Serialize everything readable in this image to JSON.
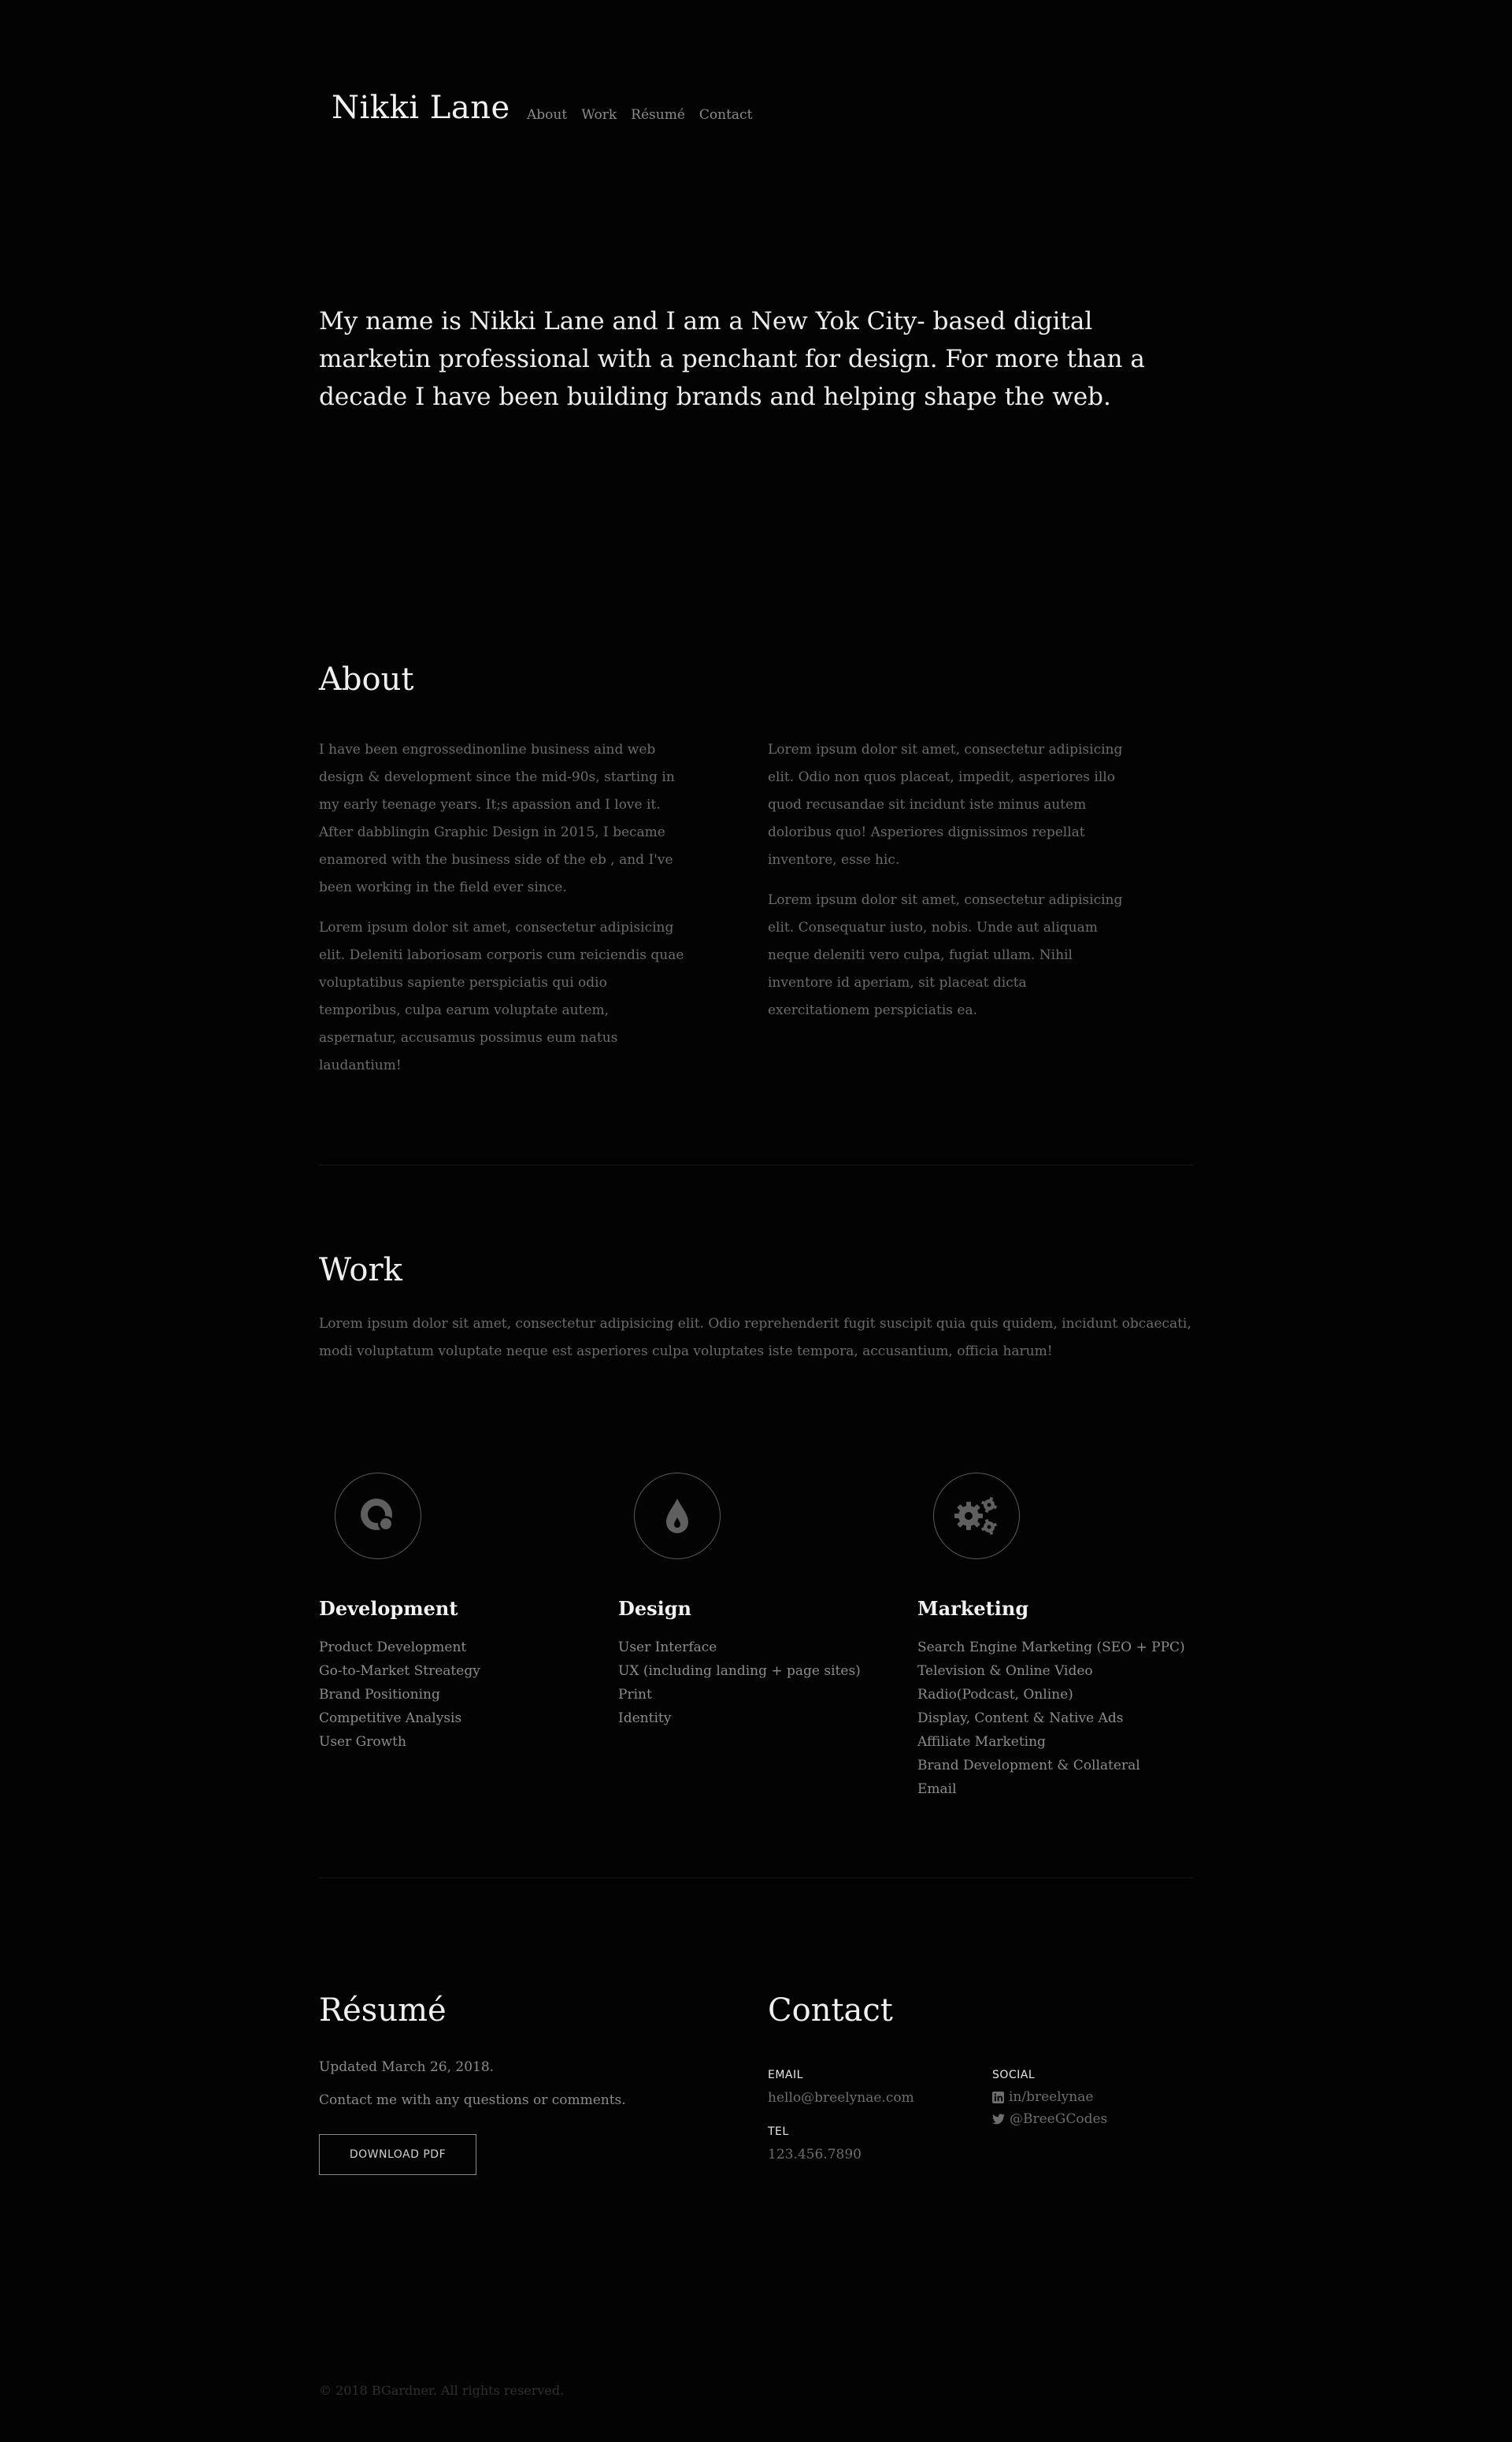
{
  "header": {
    "brand": "Nikki Lane",
    "nav": [
      "About",
      "Work",
      "Résumé",
      "Contact"
    ]
  },
  "intro": "My name is Nikki Lane and I am a New Yok City- based digital marketin professional with a penchant for design. For more than a decade I have been building brands and helping shape the web.",
  "about": {
    "title": "About",
    "left": [
      "I have been engrossedinonline business aind web design & development since the mid-90s, starting in my early teenage years. It;s apassion and I love it. After dabblingin Graphic Design in 2015, I became enamored with the business side of the eb , and I've been working in the field ever since.",
      "Lorem ipsum dolor sit amet, consectetur adipisicing elit. Deleniti laboriosam corporis cum reiciendis quae voluptatibus sapiente perspiciatis qui odio temporibus, culpa earum voluptate autem, aspernatur, accusamus possimus eum natus laudantium!"
    ],
    "right": [
      "Lorem ipsum dolor sit amet, consectetur adipisicing elit. Odio non quos placeat, impedit, asperiores illo quod recusandae sit incidunt iste minus autem doloribus quo! Asperiores dignissimos repellat inventore, esse hic.",
      "Lorem ipsum dolor sit amet, consectetur adipisicing elit. Consequatur iusto, nobis. Unde aut aliquam neque deleniti vero culpa, fugiat ullam. Nihil inventore id aperiam, sit placeat dicta exercitationem perspiciatis ea."
    ]
  },
  "work": {
    "title": "Work",
    "intro": "Lorem ipsum dolor sit amet, consectetur adipisicing elit. Odio reprehenderit fugit suscipit quia quis quidem, incidunt obcaecati, modi voluptatum voluptate neque est asperiores culpa voluptates iste tempora, accusantium, officia harum!",
    "columns": [
      {
        "icon": "development-icon",
        "title": "Development",
        "items": [
          "Product Development",
          "Go-to-Market Streategy",
          "Brand Positioning",
          "Competitive Analysis",
          "User Growth"
        ]
      },
      {
        "icon": "droplet-icon",
        "title": "Design",
        "items": [
          "User Interface",
          "UX (including landing + page sites)",
          "Print",
          "Identity"
        ]
      },
      {
        "icon": "gears-icon",
        "title": "Marketing",
        "items": [
          "Search Engine Marketing (SEO + PPC)",
          "Television & Online Video",
          "Radio(Podcast, Online)",
          "Display, Content & Native Ads",
          "Affiliate Marketing",
          "Brand Development & Collateral",
          "Email"
        ]
      }
    ]
  },
  "resume": {
    "title": "Résumé",
    "updated": "Updated March 26, 2018.",
    "contact_note": "Contact me with any questions or comments.",
    "button": "DOWNLOAD PDF"
  },
  "contact": {
    "title": "Contact",
    "email_label": "EMAIL",
    "email": "hello@breelynae.com",
    "tel_label": "TEL",
    "tel": "123.456.7890",
    "social_label": "SOCIAL",
    "linkedin": "in/breelynae",
    "twitter": "@BreeGCodes"
  },
  "footer": "© 2018 BGardner. All rights reserved."
}
